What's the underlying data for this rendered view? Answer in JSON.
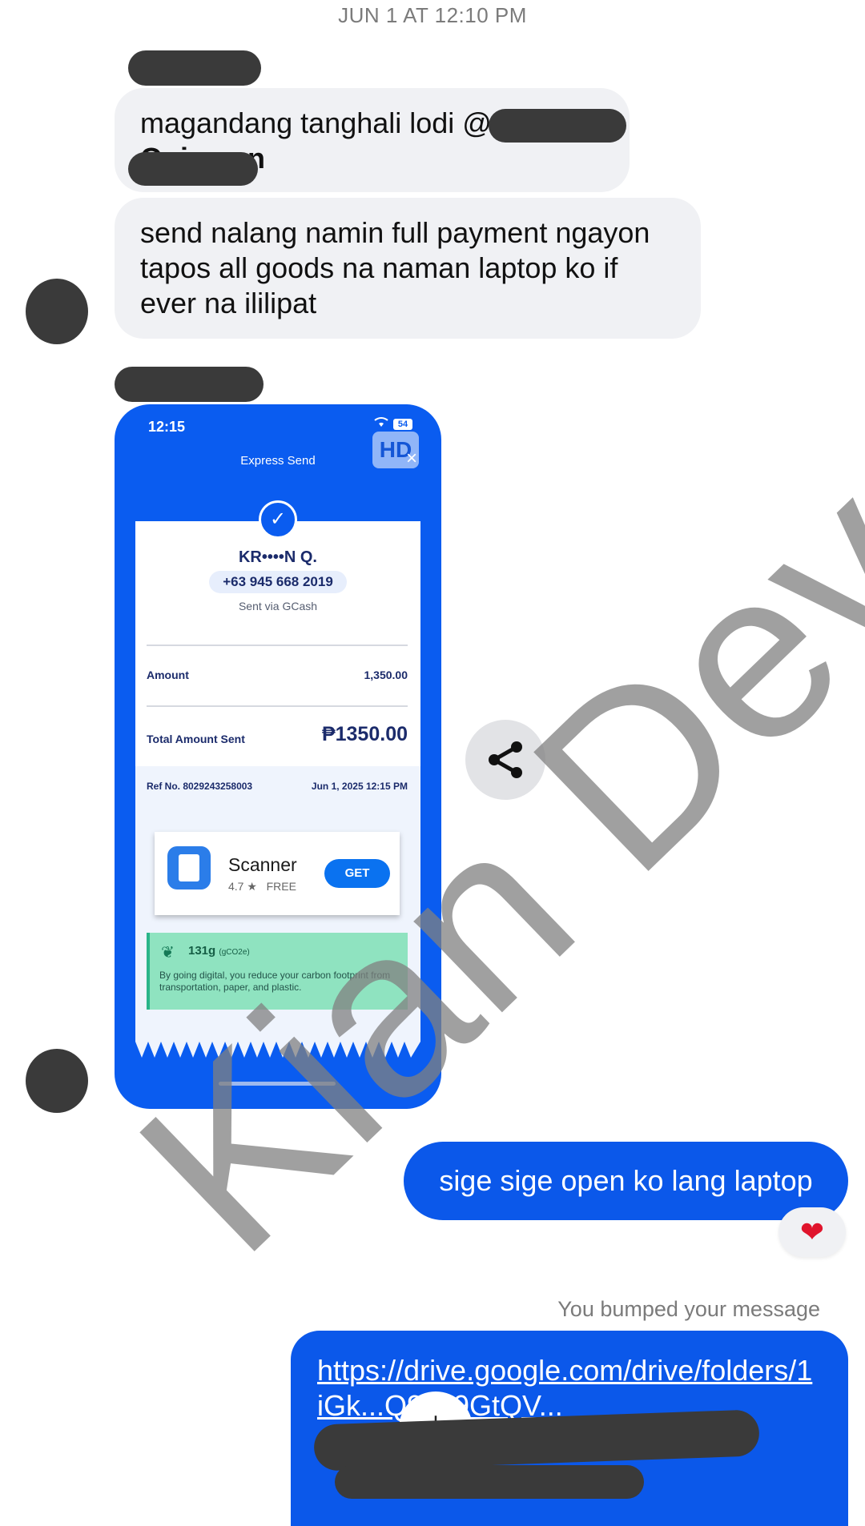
{
  "conversation": {
    "timestamp": "JUN 1 AT 12:10 PM",
    "messages_in": [
      {
        "text_line1": "magandang tanghali lodi @",
        "text_line2": "Quimeon"
      },
      {
        "text_line1": "send nalang namin full payment ngayon",
        "text_line2": "tapos all goods na naman laptop ko if",
        "text_line3": "ever na ililipat"
      }
    ],
    "messages_out": [
      {
        "text": "sige sige open ko lang laptop",
        "reaction": "❤"
      }
    ],
    "bumped_notice": "You bumped your message",
    "link_message": {
      "text": "https://drive.google.com/drive/folders/1iGk...Q9Gt9GtQV..."
    }
  },
  "shared_image": {
    "status_time": "12:15",
    "battery": "54",
    "hd_badge": "HD",
    "screen_title": "Express Send",
    "recipient_name": "KR••••N Q.",
    "recipient_phone": "+63 945 668 2019",
    "sent_via": "Sent via GCash",
    "amount_label": "Amount",
    "amount_value": "1,350.00",
    "total_label": "Total Amount Sent",
    "total_value": "₱1350.00",
    "ref_label": "Ref No. 8029243258003",
    "ref_date": "Jun 1, 2025 12:15 PM",
    "ad": {
      "name": "Scanner",
      "rating": "4.7 ★",
      "price": "FREE",
      "button": "GET"
    },
    "eco": {
      "title": "131g",
      "unit": "(gCO2e)",
      "text": "By going digital, you reduce your carbon footprint from transportation, paper, and plastic."
    }
  },
  "watermark": {
    "text": "Kian Dev",
    "color": "#808080"
  },
  "colors": {
    "outgoing_bubble": "#0b58ea",
    "incoming_bubble": "#f0f1f4",
    "gcash_blue": "#0a5cf0"
  },
  "icons": [
    "share-icon",
    "download-icon",
    "heart-icon",
    "check-icon",
    "close-icon",
    "leaf-icon",
    "wifi-icon"
  ]
}
